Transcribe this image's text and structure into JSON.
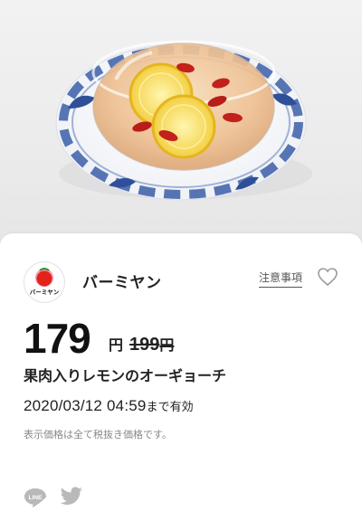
{
  "photo": {
    "alt_subject": "lemon-dessert-photo"
  },
  "coupon": {
    "shop_name": "バーミヤン",
    "logo_text": "バーミヤン",
    "notes_label": "注意事項",
    "price": "179",
    "price_unit": "円",
    "original_price": "199",
    "original_price_unit": "円",
    "product_name": "果肉入りレモンのオーギョーチ",
    "expiry_datetime": "2020/03/12 04:59",
    "expiry_suffix": "まで有効",
    "tax_note": "表示価格は全て税抜き価格です。"
  },
  "share": {
    "line_label": "LINE",
    "twitter_icon": "twitter-icon"
  },
  "colors": {
    "logo_red": "#e2231a",
    "logo_peach": "#f39bb4",
    "plate_blue": "#3b5ea8",
    "syrup_amber": "#e8b98a"
  }
}
